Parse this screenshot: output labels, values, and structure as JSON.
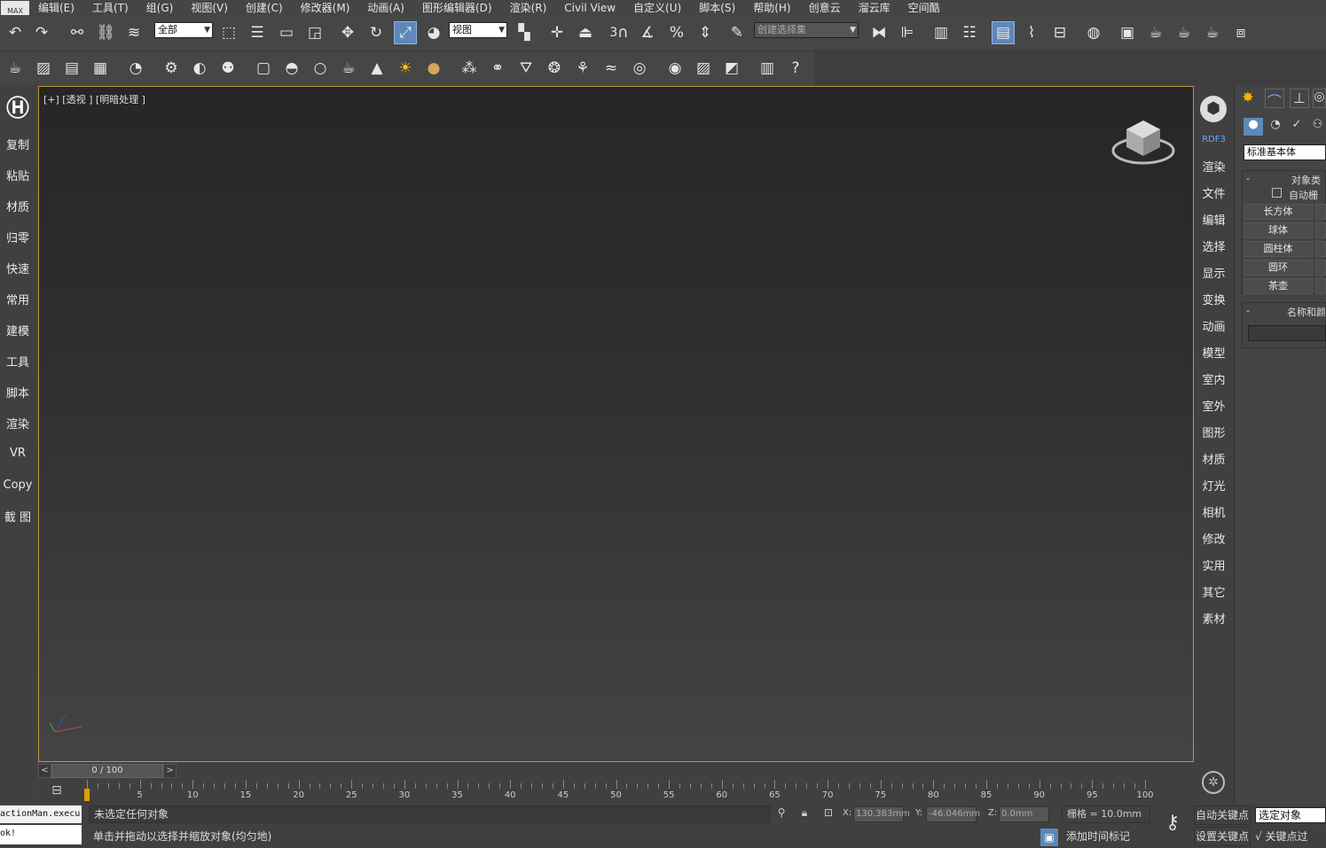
{
  "menu": {
    "logo": "MAX",
    "items": [
      "编辑(E)",
      "工具(T)",
      "组(G)",
      "视图(V)",
      "创建(C)",
      "修改器(M)",
      "动画(A)",
      "图形编辑器(D)",
      "渲染(R)",
      "Civil View",
      "自定义(U)",
      "脚本(S)",
      "帮助(H)",
      "创意云",
      "溜云库",
      "空间酷"
    ]
  },
  "toolbar": {
    "filter_value": "全部",
    "refcoord_value": "视图",
    "selset_placeholder": "创建选择集",
    "snap_num": "3",
    "percent_label": "%"
  },
  "left_panel": {
    "items": [
      "复制",
      "粘贴",
      "材质",
      "归零",
      "快速",
      "常用",
      "建模",
      "工具",
      "脚本",
      "渲染",
      "VR",
      "Copy",
      "截 图"
    ]
  },
  "viewport": {
    "label": "[+] [透视 ] [明暗处理 ]"
  },
  "right_panel": {
    "top_label": "RDF3",
    "items": [
      "渲染",
      "文件",
      "编辑",
      "选择",
      "显示",
      "变换",
      "动画",
      "模型",
      "室内",
      "室外",
      "图形",
      "材质",
      "灯光",
      "相机",
      "修改",
      "实用",
      "其它",
      "素材"
    ]
  },
  "command_panel": {
    "category": "标准基本体",
    "section_object_type": "对象类",
    "autogrid": "自动栅",
    "buttons": [
      "长方体",
      "球体",
      "圆柱体",
      "圆环",
      "茶壶"
    ],
    "section_name": "名称和颜"
  },
  "timeline": {
    "frame_display": "0 / 100",
    "ticks": [
      "5",
      "10",
      "15",
      "20",
      "25",
      "30",
      "35",
      "40",
      "45",
      "50",
      "55",
      "60",
      "65",
      "70",
      "75",
      "80",
      "85",
      "90",
      "95",
      "100"
    ]
  },
  "status": {
    "listener": "actionMan.execu",
    "listener_ok": "ok!",
    "line1": "未选定任何对象",
    "line2": "单击并拖动以选择并缩放对象(均匀地)",
    "x_label": "X:",
    "x_value": "130.383mm",
    "y_label": "Y:",
    "y_value": "-46.046mm",
    "z_label": "Z:",
    "z_value": "0.0mm",
    "grid": "栅格 = 10.0mm",
    "add_tag": "添加时间标记",
    "autokey": "自动关键点",
    "setkey": "设置关键点",
    "sel_dropdown": "选定对象",
    "key_filters": "关键点过"
  }
}
